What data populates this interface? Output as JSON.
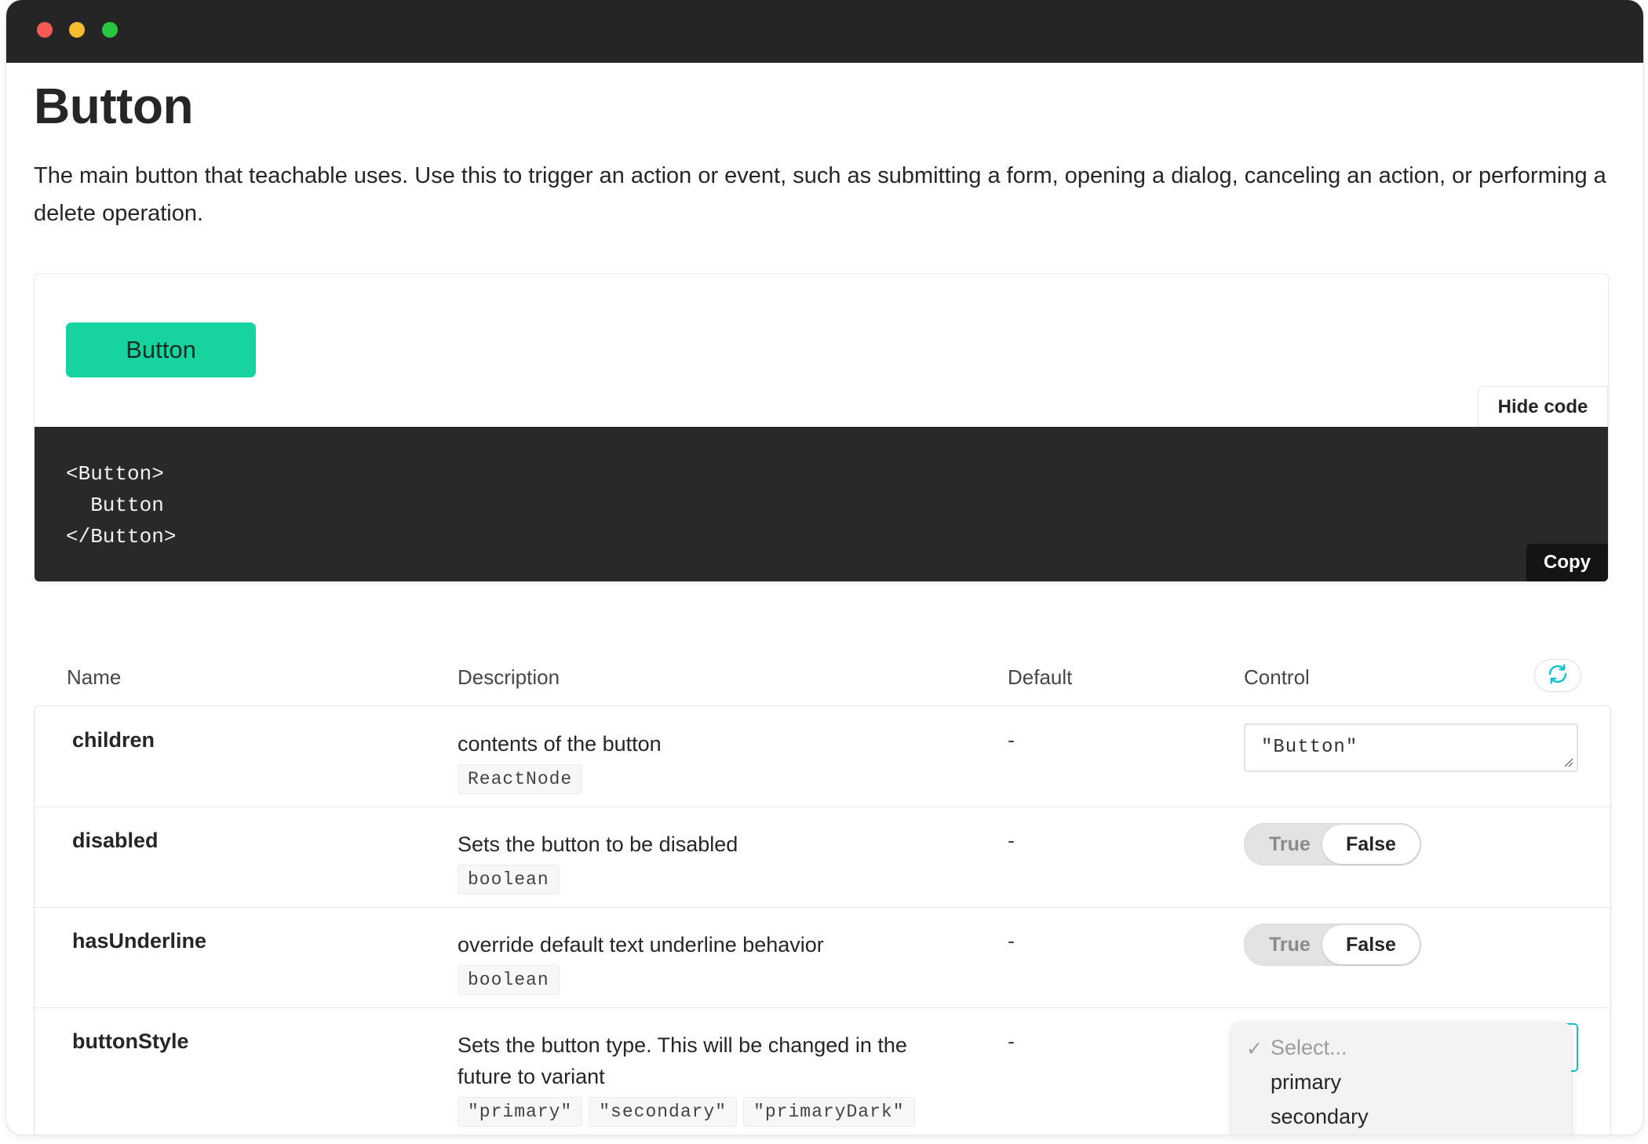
{
  "page": {
    "title": "Button",
    "description": "The main button that teachable uses. Use this to trigger an action or event, such as submitting a form, opening a dialog, canceling an action, or performing a delete operation."
  },
  "preview": {
    "button_label": "Button",
    "hide_code_label": "Hide code",
    "code_lines": [
      "<Button>",
      "  Button",
      "</Button>"
    ],
    "copy_label": "Copy"
  },
  "props_table": {
    "headers": {
      "name": "Name",
      "description": "Description",
      "default": "Default",
      "control": "Control"
    },
    "rows": [
      {
        "name": "children",
        "description": "contents of the button",
        "types": [
          "ReactNode"
        ],
        "default": "-",
        "control": {
          "type": "text",
          "value": "\"Button\""
        }
      },
      {
        "name": "disabled",
        "description": "Sets the button to be disabled",
        "types": [
          "boolean"
        ],
        "default": "-",
        "control": {
          "type": "toggle",
          "true_label": "True",
          "false_label": "False",
          "selected": "False"
        }
      },
      {
        "name": "hasUnderline",
        "description": "override default text underline behavior",
        "types": [
          "boolean"
        ],
        "default": "-",
        "control": {
          "type": "toggle",
          "true_label": "True",
          "false_label": "False",
          "selected": "False"
        }
      },
      {
        "name": "buttonStyle",
        "description": "Sets the button type. This will be changed in the future to variant",
        "types": [
          "\"primary\"",
          "\"secondary\"",
          "\"primaryDark\""
        ],
        "default": "-",
        "control": {
          "type": "select",
          "options": [
            "Select...",
            "primary",
            "secondary"
          ],
          "selected": "Select..."
        }
      }
    ]
  },
  "icons": {
    "reset": "sync-icon",
    "check": "checkmark-icon"
  },
  "colors": {
    "accent": "#17d3a0",
    "code_bg": "#292929",
    "titlebar": "#252525",
    "focus": "#17bfd0"
  }
}
